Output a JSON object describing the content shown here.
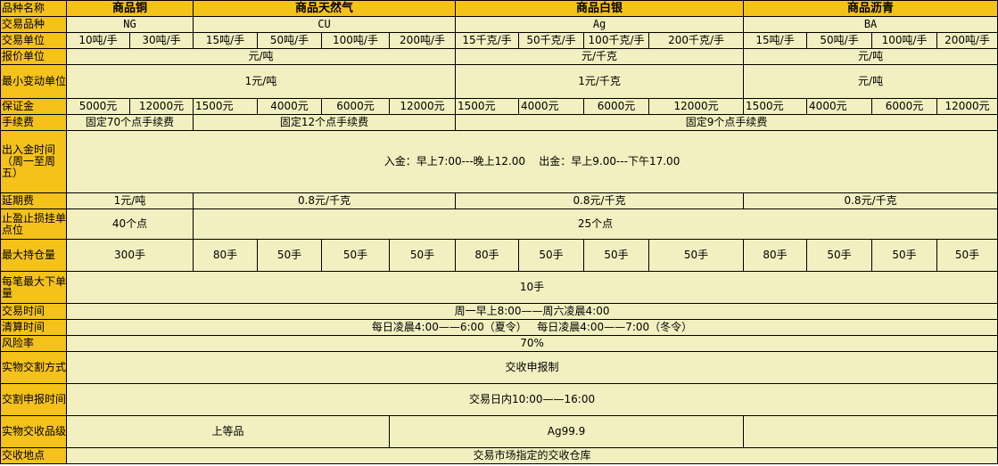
{
  "headers": [
    "品种名称",
    "商品铜",
    "商品天然气",
    "商品白银",
    "商品沥青"
  ],
  "rows": {
    "variety": {
      "label": "交易品种",
      "cu": "NG",
      "ng": "CU",
      "ag": "Ag",
      "ba": "BA"
    },
    "unit": {
      "label": "交易单位",
      "values": [
        "10吨/手",
        "30吨/手",
        "15吨/手",
        "50吨/手",
        "100吨/手",
        "200吨/手",
        "15千克/手",
        "50千克/手",
        "100千克/手",
        "200千克/手",
        "15吨/手",
        "50吨/手",
        "100吨/手",
        "200吨/手"
      ]
    },
    "quote": {
      "label": "报价单位",
      "a": "元/吨",
      "b": "元/千克",
      "c": "元/吨"
    },
    "tick": {
      "label": "最小变动单位",
      "a": "1元/吨",
      "b": "1元/千克",
      "c": "元/吨"
    },
    "margin": {
      "label": "保证金",
      "values": [
        "5000元",
        "12000元",
        "1500元",
        "4000元",
        "6000元",
        "12000元",
        "1500元",
        "4000元",
        "6000元",
        "12000元",
        "1500元",
        "4000元",
        "6000元",
        "12000元"
      ]
    },
    "fee": {
      "label": "手续费",
      "a": "固定70个点手续费",
      "b": "固定12个点手续费",
      "c": "固定9个点手续费"
    },
    "funds": {
      "label": "出入金时间（周一至周五）",
      "value": "入金：早上7:00---晚上12.00    出金：早上9.00---下午17.00"
    },
    "defer": {
      "label": "延期费",
      "a": "1元/吨",
      "b": "0.8元/千克",
      "c": "0.8元/千克",
      "d": "0.8元/千克"
    },
    "stop": {
      "label": "止盈止损挂单点位",
      "a": "40个点",
      "b": "25个点"
    },
    "maxpos": {
      "label": "最大持仓量",
      "values": [
        "300手",
        "80手",
        "50手",
        "50手",
        "50手",
        "80手",
        "50手",
        "50手",
        "50手",
        "80手",
        "50手",
        "50手",
        "50手"
      ]
    },
    "maxorder": {
      "label": "每笔最大下单量",
      "value": "10手"
    },
    "hours": {
      "label": "交易时间",
      "value": "周一早上8:00——周六凌晨4:00"
    },
    "settle": {
      "label": "清算时间",
      "value": "每日凌晨4:00——6:00（夏令）   每日凌晨4:00——7:00（冬令）"
    },
    "risk": {
      "label": "风险率",
      "value": "70%"
    },
    "delivery_method": {
      "label": "实物交割方式",
      "value": "交收申报制"
    },
    "delivery_time": {
      "label": "交割申报时间",
      "value": "交易日内10:00——16:00"
    },
    "grade": {
      "label": "实物交收品级",
      "a": "上等品",
      "b": "Ag99.9",
      "c": ""
    },
    "place": {
      "label": "交收地点",
      "value": "交易市场指定的交收仓库"
    }
  }
}
